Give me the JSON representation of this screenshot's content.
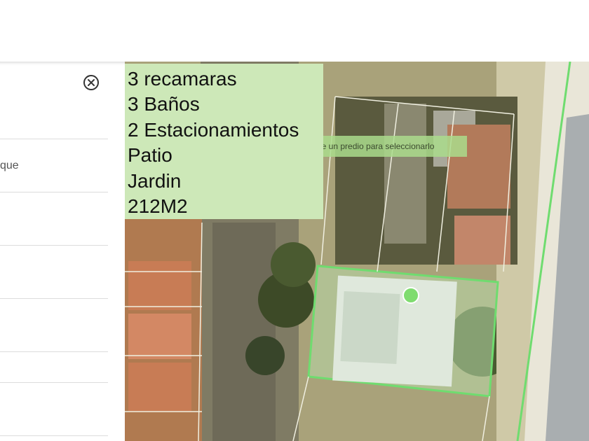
{
  "sidebar": {
    "visible_text": "que"
  },
  "map": {
    "hint": "bre un predio para seleccionarlo",
    "info_lines": [
      "3 recamaras",
      "3 Baños",
      "2 Estacionamientos",
      "Patio",
      "Jardin",
      "212M2"
    ],
    "colors": {
      "parcel_outline": "#6fdc6f",
      "highlight_fill": "#cde8b8",
      "marker": "#6fdc6f"
    }
  }
}
